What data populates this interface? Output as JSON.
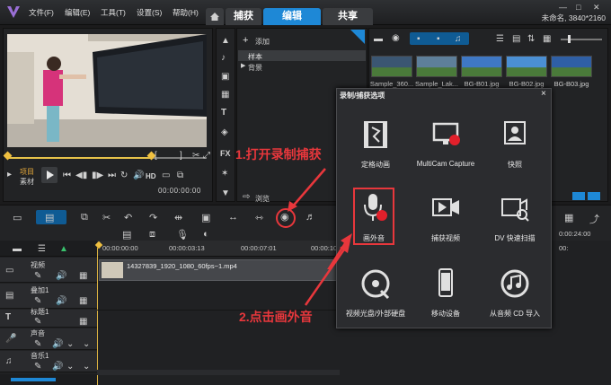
{
  "menubar": {
    "items": [
      "文件(F)",
      "编辑(E)",
      "工具(T)",
      "设置(S)",
      "帮助(H)"
    ],
    "tabs": [
      "捕获",
      "编辑",
      "共享"
    ],
    "project_info": "未命名, 3840*2160",
    "window_controls": [
      "—",
      "□",
      "✕"
    ]
  },
  "player": {
    "project_label": "项目",
    "clip_label": "素材",
    "hd_label": "HD",
    "timecode": "00:00:00:00"
  },
  "library": {
    "add_label": "添加",
    "tree_items": [
      "样本",
      "背景"
    ],
    "browse_label": "浏览",
    "thumbnails": [
      {
        "label": "Sample_360...",
        "color": "#3b5672"
      },
      {
        "label": "Sample_Lak...",
        "color": "#5e7f9a"
      },
      {
        "label": "BG-B01.jpg",
        "color": "#3f78c4"
      },
      {
        "label": "BG-B02.jpg",
        "color": "#4b8fd3"
      },
      {
        "label": "BG-B03.jpg",
        "color": "#2f5fa5"
      }
    ]
  },
  "dialog": {
    "title": "录制/捕获选项",
    "close": "×",
    "items": [
      {
        "label": "定格动画",
        "icon": "stop-motion-icon"
      },
      {
        "label": "MultiCam Capture",
        "icon": "multicam-icon"
      },
      {
        "label": "快照",
        "icon": "snapshot-icon"
      },
      {
        "label": "画外音",
        "icon": "microphone-icon"
      },
      {
        "label": "捕获视频",
        "icon": "capture-video-icon"
      },
      {
        "label": "DV 快速扫描",
        "icon": "dv-scan-icon"
      },
      {
        "label": "视频光盘/外部硬盘",
        "icon": "disc-icon"
      },
      {
        "label": "移动设备",
        "icon": "mobile-device-icon"
      },
      {
        "label": "从音频 CD 导入",
        "icon": "audio-cd-icon"
      }
    ]
  },
  "annotations": {
    "step1": "1.打开录制捕获",
    "step2": "2.点击画外音"
  },
  "timeline": {
    "ruler": [
      "00:00:00:00",
      "00:00:03:13",
      "00:00:07:01",
      "00:00:10:14"
    ],
    "right_timecode": "0:00:24:00",
    "right_ruler": [
      "00:"
    ],
    "tracks": [
      {
        "name": "视频"
      },
      {
        "name": "叠加1"
      },
      {
        "name": "标题1"
      },
      {
        "name": "声音"
      },
      {
        "name": "音乐1"
      }
    ],
    "clip_label": "14327839_1920_1080_60fps~1.mp4"
  },
  "colors": {
    "accent": "#1e88d6",
    "annotation": "#e8373c",
    "record_dot": "#e2202b"
  }
}
